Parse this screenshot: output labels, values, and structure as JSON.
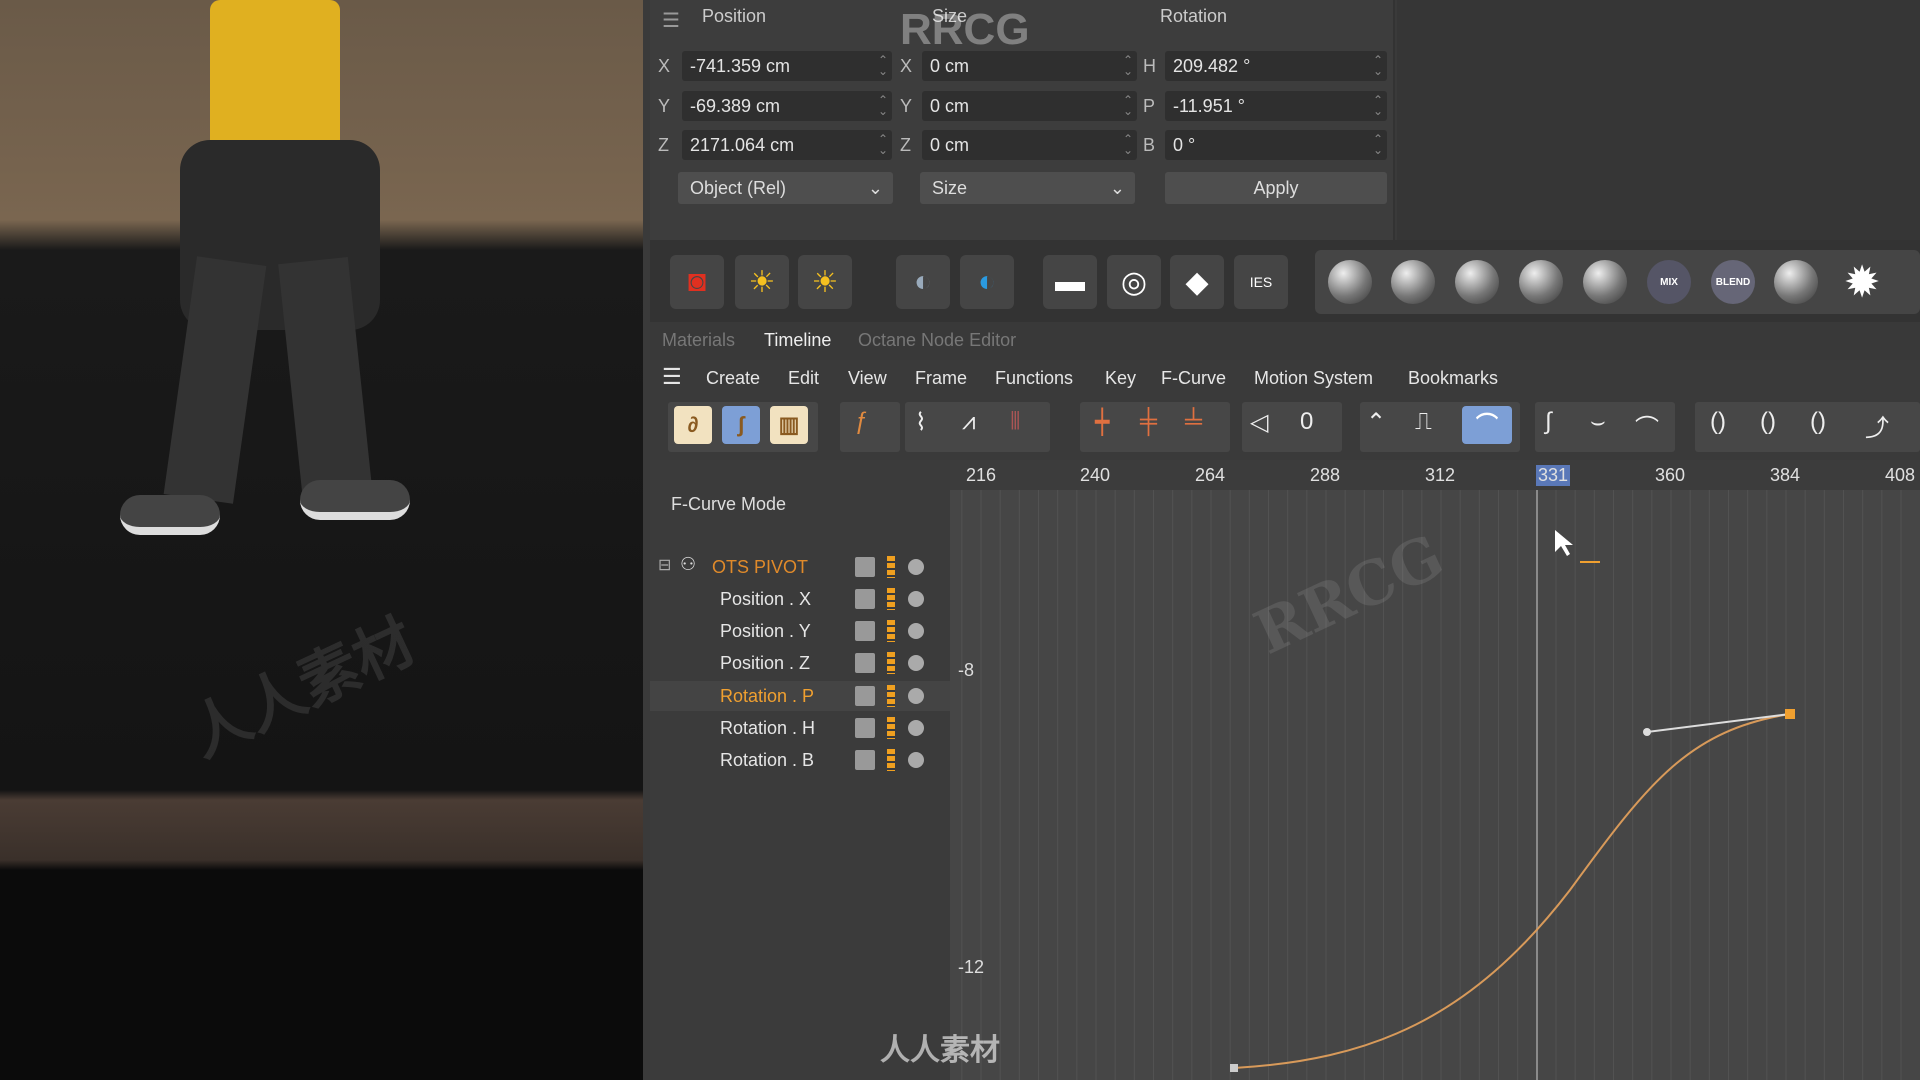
{
  "attributes": {
    "headers": {
      "position": "Position",
      "size": "Size",
      "rotation": "Rotation"
    },
    "position": [
      {
        "axis": "X",
        "value": "-741.359 cm"
      },
      {
        "axis": "Y",
        "value": "-69.389 cm"
      },
      {
        "axis": "Z",
        "value": "2171.064 cm"
      }
    ],
    "size": [
      {
        "axis": "X",
        "value": "0 cm"
      },
      {
        "axis": "Y",
        "value": "0 cm"
      },
      {
        "axis": "Z",
        "value": "0 cm"
      }
    ],
    "rotation": [
      {
        "axis": "H",
        "value": "209.482 °"
      },
      {
        "axis": "P",
        "value": "-11.951 °"
      },
      {
        "axis": "B",
        "value": "0 °"
      }
    ],
    "coord_mode": "Object (Rel)",
    "size_mode": "Size",
    "apply": "Apply"
  },
  "material_spheres": [
    "MIX",
    "BLEND"
  ],
  "tabs": [
    {
      "label": "Materials",
      "active": false
    },
    {
      "label": "Timeline",
      "active": true
    },
    {
      "label": "Octane Node Editor",
      "active": false
    }
  ],
  "menu": [
    "Create",
    "Edit",
    "View",
    "Frame",
    "Functions",
    "Key",
    "F-Curve",
    "Motion System",
    "Bookmarks"
  ],
  "mode_label": "F-Curve Mode",
  "tracks": [
    {
      "label": "OTS PIVOT",
      "color": "#e08a2a"
    },
    {
      "label": "Position . X",
      "color": "#e6e6e6"
    },
    {
      "label": "Position . Y",
      "color": "#e6e6e6"
    },
    {
      "label": "Position . Z",
      "color": "#e6e6e6"
    },
    {
      "label": "Rotation . P",
      "color": "#f0a030"
    },
    {
      "label": "Rotation . H",
      "color": "#e6e6e6"
    },
    {
      "label": "Rotation . B",
      "color": "#e6e6e6"
    }
  ],
  "ruler": {
    "ticks": [
      "216",
      "240",
      "264",
      "288",
      "312",
      "360",
      "384",
      "408"
    ],
    "current_frame": "331"
  },
  "value_labels": [
    "-8",
    "-12"
  ],
  "curve_color": "#d89a5a",
  "watermarks": [
    "RRCG",
    "人人素材"
  ]
}
